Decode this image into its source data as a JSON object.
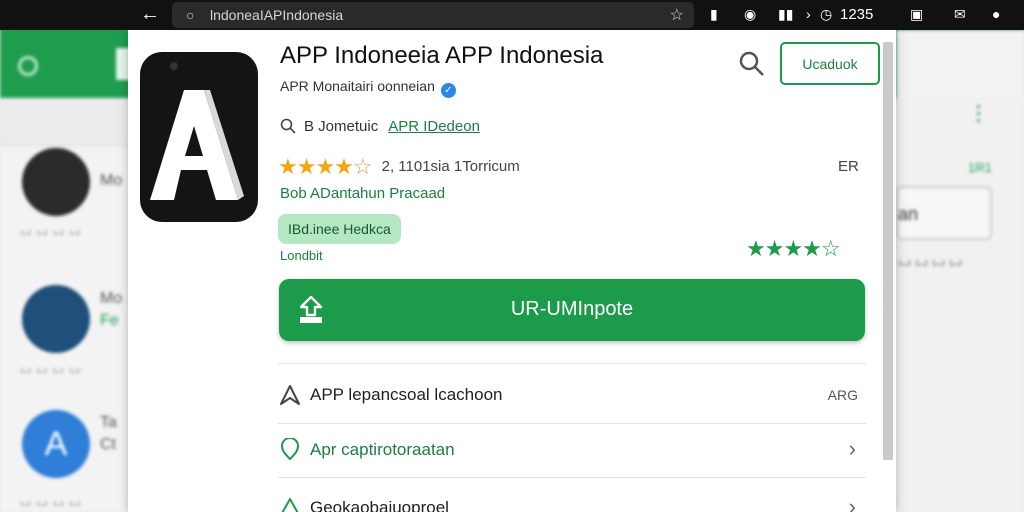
{
  "status_bar": {
    "url": "lndoneaIAPIndonesia",
    "time": "1235",
    "icons": [
      "back-arrow-icon",
      "lock-icon",
      "star-icon",
      "file-icon",
      "app-icon",
      "signal-icon",
      "alarm-icon",
      "camera-icon",
      "mail-icon",
      "avatar-icon"
    ]
  },
  "background": {
    "list_items": [
      {
        "title": "Mo",
        "meta": "ꙍ ꙍ ꙍ ꙍ"
      },
      {
        "title": "Mo",
        "sub": "Fe",
        "meta": "ꙍ ꙍ ꙍ ꙍ"
      },
      {
        "title": "Ta",
        "sub": "Ct",
        "meta": "ꙍ ꙍ ꙍ ꙍ"
      }
    ],
    "right_panel": {
      "count": "1R1",
      "button": "an",
      "meta": "ꙍ ꙍ ꙍ ꙍ"
    }
  },
  "app": {
    "title": "APP Indoneeia APP Indonesia",
    "developer": "APR Monaitairi oonneian",
    "header_button": "Ucaduok",
    "category_prefix": "B Jometuic",
    "category_link": "APR IDedeon",
    "rating": 4.5,
    "rating_text": "2, 1101sia 1Torricum",
    "age_rating": "ER",
    "developer_link": "Bob ADantahun Pracaad",
    "badge": "IBd.inee Hedkca",
    "badge_sub": "Londbit",
    "secondary_rating": 4.5,
    "install_label": "UR-UMInpote"
  },
  "details": [
    {
      "label": "APP lepancsoal lcachoon",
      "value": "ARG",
      "icon": "navigate-icon",
      "style": "default"
    },
    {
      "label": "Apr captirotoraatan",
      "value": "",
      "icon": "shield-icon",
      "style": "green"
    },
    {
      "label": "Geokaobajuoproel",
      "value": "",
      "icon": "info-icon",
      "style": "default"
    }
  ],
  "colors": {
    "accent": "#1c9b4b",
    "accent_text": "#1a7f40",
    "badge_bg": "#b6e7c3",
    "star": "#f2a712"
  }
}
